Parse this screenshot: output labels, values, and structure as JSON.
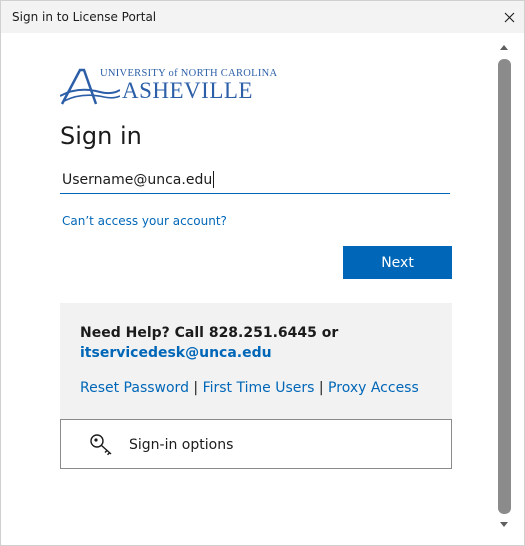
{
  "window": {
    "title": "Sign in to License Portal",
    "close_icon": "close-icon"
  },
  "logo": {
    "top_text": "UNIVERSITY of NORTH CAROLINA",
    "main_text": "ASHEVILLE",
    "color": "#2c5fa8"
  },
  "form": {
    "heading": "Sign in",
    "username_value": "Username@unca.edu",
    "cant_access_link": "Can’t access your account?",
    "next_label": "Next"
  },
  "help": {
    "line1": "Need Help? Call 828.251.6445 or",
    "email": "itservicedesk@unca.edu",
    "links": [
      "Reset Password",
      "First Time Users",
      "Proxy Access"
    ],
    "separator": "|"
  },
  "signin_options": {
    "label": "Sign-in options",
    "icon": "key-icon"
  },
  "colors": {
    "accent": "#0067b8",
    "help_bg": "#f2f2f2",
    "titlebar_bg": "#f3f3f3"
  }
}
